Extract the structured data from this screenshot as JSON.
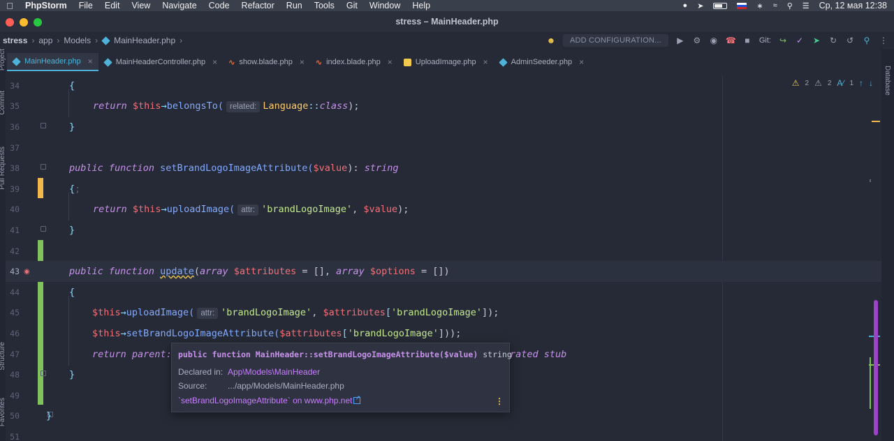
{
  "menubar": {
    "app_name": "PhpStorm",
    "items": [
      "File",
      "Edit",
      "View",
      "Navigate",
      "Code",
      "Refactor",
      "Run",
      "Tools",
      "Git",
      "Window",
      "Help"
    ],
    "clock": "Ср, 12 мая  12:38"
  },
  "window": {
    "title": "stress – MainHeader.php"
  },
  "breadcrumb": {
    "project": "stress",
    "dir1": "app",
    "dir2": "Models",
    "file": "MainHeader.php"
  },
  "toolbar": {
    "add_configuration": "ADD CONFIGURATION...",
    "git_label": "Git:"
  },
  "tabs": [
    {
      "label": "MainHeader.php",
      "kind": "php"
    },
    {
      "label": "MainHeaderController.php",
      "kind": "php"
    },
    {
      "label": "show.blade.php",
      "kind": "blade"
    },
    {
      "label": "index.blade.php",
      "kind": "blade"
    },
    {
      "label": "UploadImage.php",
      "kind": "trait"
    },
    {
      "label": "AdminSeeder.php",
      "kind": "php"
    }
  ],
  "inspection": {
    "warnings": "2",
    "weak_warnings": "2",
    "typos": "1"
  },
  "side_labels": {
    "right": "Database",
    "left_top": "Project",
    "left_mid": "Commit",
    "left_pr": "Pull Requests",
    "left_struct": "Structure",
    "left_fav": "Favorites"
  },
  "lines": {
    "n34": "34",
    "n35": "35",
    "n36": "36",
    "n37": "37",
    "n38": "38",
    "n39": "39",
    "n40": "40",
    "n41": "41",
    "n42": "42",
    "n43": "43",
    "n44": "44",
    "n45": "45",
    "n46": "46",
    "n47": "47",
    "n48": "48",
    "n49": "49",
    "n50": "50",
    "n51": "51"
  },
  "code": {
    "brace_open": "{",
    "brace_close": "}",
    "return": "return",
    "this": "$this",
    "arrow": "→",
    "belongs_to": "belongsTo(",
    "hint_related": "related:",
    "language_cls": "Language",
    "dbl_colon": "::",
    "class_kw": "class",
    "close_semi": ");",
    "public": "public",
    "function": "function",
    "set_brand": "setBrandLogoImageAttribute(",
    "param_value": "$value",
    "close_colon": "): ",
    "string_type": "string",
    "semi_dim": ";",
    "upload_image": "uploadImage(",
    "hint_attr": "attr:",
    "str_brand": "'brandLogoImage'",
    "comma": ", ",
    "update_fn": "update",
    "paren_open": "(",
    "array_kw": "array",
    "param_attributes": "$attributes",
    "eq_empty": " = []",
    "param_options": "$options",
    "eq_empty_close": " = [])",
    "bracket_open": "[",
    "bracket_close_semi": "]);",
    "bracket_close_paren": "])",
    "parent_text": "parent:",
    "stub_text": "rated stub",
    "final_brace": "}"
  },
  "popup": {
    "sig_kw": "public function",
    "sig_name": "MainHeader::setBrandLogoImageAttribute($value)",
    "sig_type": "string",
    "declared_label": "Declared in:",
    "declared_value": "App\\Models\\MainHeader",
    "source_label": "Source:",
    "source_value": ".../app/Models/MainHeader.php",
    "doc_link": "`setBrandLogoImageAttribute` on www.php.net"
  },
  "colors": {
    "accent": "#4fb3d9",
    "vcs_added": "#7fc35a",
    "vcs_modified": "#f2b84b",
    "scroll_thumb": "#9d43c9"
  }
}
